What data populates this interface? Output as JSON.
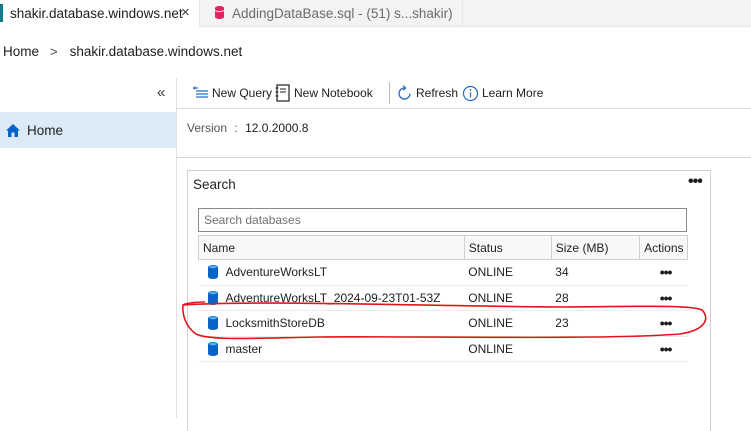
{
  "tabs": [
    {
      "label": "shakir.database.windows.net",
      "active": true,
      "close_glyph": "×",
      "icon": "server-icon"
    },
    {
      "label": "AddingDataBase.sql - (51) s...shakir)",
      "active": false,
      "icon": "database-icon"
    }
  ],
  "breadcrumb": {
    "home": "Home",
    "separator": ">",
    "current": "shakir.database.windows.net"
  },
  "sidebar": {
    "collapse_glyph": "«",
    "items": [
      {
        "label": "Home",
        "icon": "home-icon",
        "selected": true
      }
    ]
  },
  "toolbar": {
    "new_query": "New Query",
    "new_notebook": "New Notebook",
    "refresh": "Refresh",
    "learn_more": "Learn More"
  },
  "version": {
    "label": "Version",
    "separator": ":",
    "value": "12.0.2000.8"
  },
  "search_panel": {
    "title": "Search",
    "more_glyph": "•••",
    "placeholder": "Search databases",
    "columns": {
      "name": "Name",
      "status": "Status",
      "size": "Size (MB)",
      "actions": "Actions"
    },
    "rows": [
      {
        "name": "AdventureWorksLT",
        "status": "ONLINE",
        "size": "34",
        "actions": "•••"
      },
      {
        "name": "AdventureWorksLT_2024-09-23T01-53Z",
        "status": "ONLINE",
        "size": "28",
        "actions": "•••"
      },
      {
        "name": "LocksmithStoreDB",
        "status": "ONLINE",
        "size": "23",
        "actions": "•••"
      },
      {
        "name": "master",
        "status": "ONLINE",
        "size": "",
        "actions": "•••"
      }
    ]
  },
  "colors": {
    "accent": "#0e7c8a",
    "db_icon": "#0078d4",
    "selected_bg": "#dceaf7",
    "annotation": "#e0161b",
    "sql_icon": "#e0245e"
  }
}
